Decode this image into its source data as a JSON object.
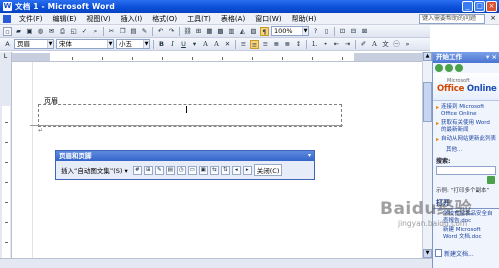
{
  "window": {
    "title": "文档 1 - Microsoft Word",
    "controls": [
      "_",
      "□",
      "×"
    ]
  },
  "menu": {
    "items": [
      "文件(F)",
      "编辑(E)",
      "视图(V)",
      "插入(I)",
      "格式(O)",
      "工具(T)",
      "表格(A)",
      "窗口(W)",
      "帮助(H)"
    ],
    "help_placeholder": "键入需要帮助的问题",
    "close": "×"
  },
  "toolbar_standard": {
    "zoom": "100%",
    "read_label": "阅读(R)"
  },
  "toolbar_format": {
    "style": "页眉",
    "font": "宋体",
    "size": "小五",
    "bold": "B",
    "italic": "I",
    "underline": "U",
    "font_color": "A"
  },
  "document": {
    "header_label": "页眉",
    "paragraph_mark": "↵"
  },
  "hf_toolbar": {
    "title": "页眉和页脚",
    "insert_autotext": "插入“自动图文集”(S) ▾",
    "close": "关闭(C)",
    "title_close": "▾"
  },
  "statusbar": {
    "text": ""
  },
  "taskpane": {
    "title": "开始工作",
    "close": "▾ ×",
    "ms_text": "Microsoft",
    "office_brand": "Office",
    "office_online": " Online",
    "links": [
      "连接到 Microsoft Office Online",
      "获取有关使用 Word 的最新新闻",
      "自动从网站更新此列表"
    ],
    "more": "其他...",
    "search_label": "搜索:",
    "example": "示例: “打印多个副本”",
    "open_heading": "打开",
    "open_files": [
      "学校食堂食品安全自查报告.doc",
      "新建 Microsoft Word 文档.doc"
    ],
    "new_doc": "新建文档..."
  },
  "watermark": {
    "main": "Baidu经验",
    "sub": "jingyan.baidu.com"
  }
}
